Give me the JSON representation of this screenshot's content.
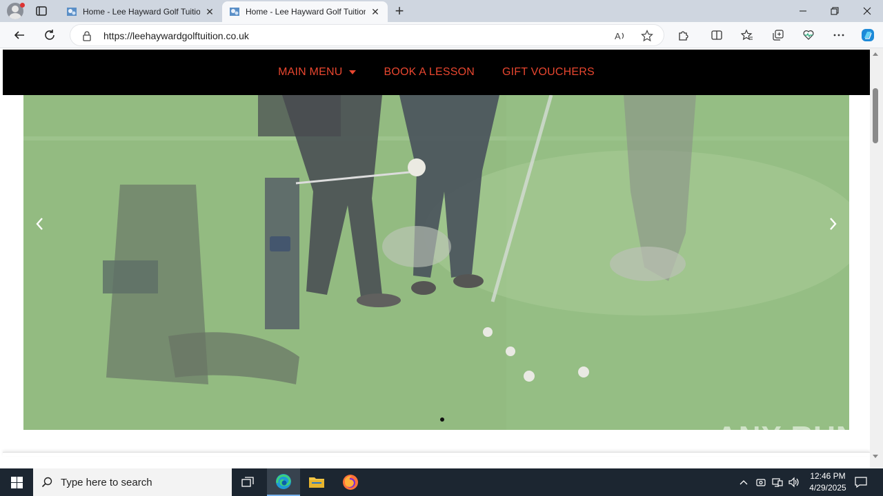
{
  "browser": {
    "tabs": [
      {
        "title": "Home - Lee Hayward Golf Tuition",
        "active": false
      },
      {
        "title": "Home - Lee Hayward Golf Tuition",
        "active": true
      }
    ],
    "url": "https://leehaywardgolftuition.co.uk",
    "icons": {
      "back": "back-arrow-icon",
      "refresh": "refresh-icon",
      "lock": "lock-icon",
      "read_aloud": "read-aloud-icon",
      "favorite": "star-icon",
      "extensions": "puzzle-icon",
      "split": "split-screen-icon",
      "favorites": "favorites-icon",
      "collections": "collections-icon",
      "performance": "heart-pulse-icon",
      "more": "more-icon",
      "copilot": "copilot-icon"
    }
  },
  "site": {
    "nav": {
      "main_menu": "MAIN MENU",
      "book": "BOOK A LESSON",
      "vouchers": "GIFT VOUCHERS"
    },
    "accent_color": "#e8462f",
    "slider": {
      "slide_count": 1,
      "active_slide": 1
    },
    "watermark": "ANY RUN"
  },
  "taskbar": {
    "search_placeholder": "Type here to search",
    "time": "12:46 PM",
    "date": "4/29/2025"
  }
}
